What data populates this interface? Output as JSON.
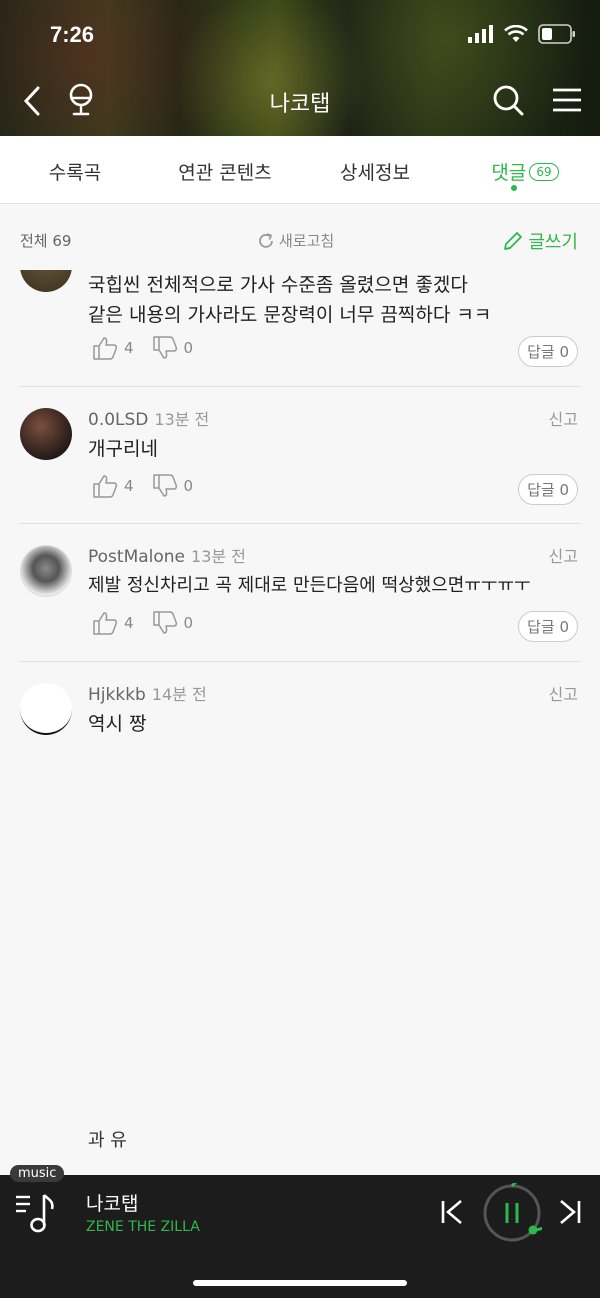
{
  "status": {
    "time": "7:26"
  },
  "header": {
    "title": "나코탭"
  },
  "tabs": [
    {
      "label": "수록곡"
    },
    {
      "label": "연관 콘텐츠"
    },
    {
      "label": "상세정보"
    },
    {
      "label": "댓글",
      "badge": "69"
    }
  ],
  "subbar": {
    "total": "전체 69",
    "refresh": "새로고침",
    "write": "글쓰기"
  },
  "comments": [
    {
      "text_lines": [
        "국힙씬 전체적으로 가사 수준좀 올렸으면 좋겠다",
        "같은 내용의 가사라도 문장력이 너무 끔찍하다 ㅋㅋ"
      ],
      "likes": "4",
      "dislikes": "0",
      "reply": "답글 0"
    },
    {
      "user": "0.0LSD",
      "time": "13분 전",
      "report": "신고",
      "text": "개구리네",
      "likes": "4",
      "dislikes": "0",
      "reply": "답글 0"
    },
    {
      "user": "PostMalone",
      "time": "13분 전",
      "report": "신고",
      "text": "제발 정신차리고 곡 제대로 만든다음에 떡상했으면ㅠㅜㅠㅜ",
      "likes": "4",
      "dislikes": "0",
      "reply": "답글 0"
    },
    {
      "user": "Hjkkkb",
      "time": "14분 전",
      "report": "신고",
      "text": "역시 짱"
    }
  ],
  "bottom_text": "과 유",
  "player": {
    "badge": "music",
    "title": "나코탭",
    "artist": "ZENE THE ZILLA"
  },
  "colors": {
    "accent": "#2fb84b",
    "player_bg": "#1c1c1c"
  }
}
